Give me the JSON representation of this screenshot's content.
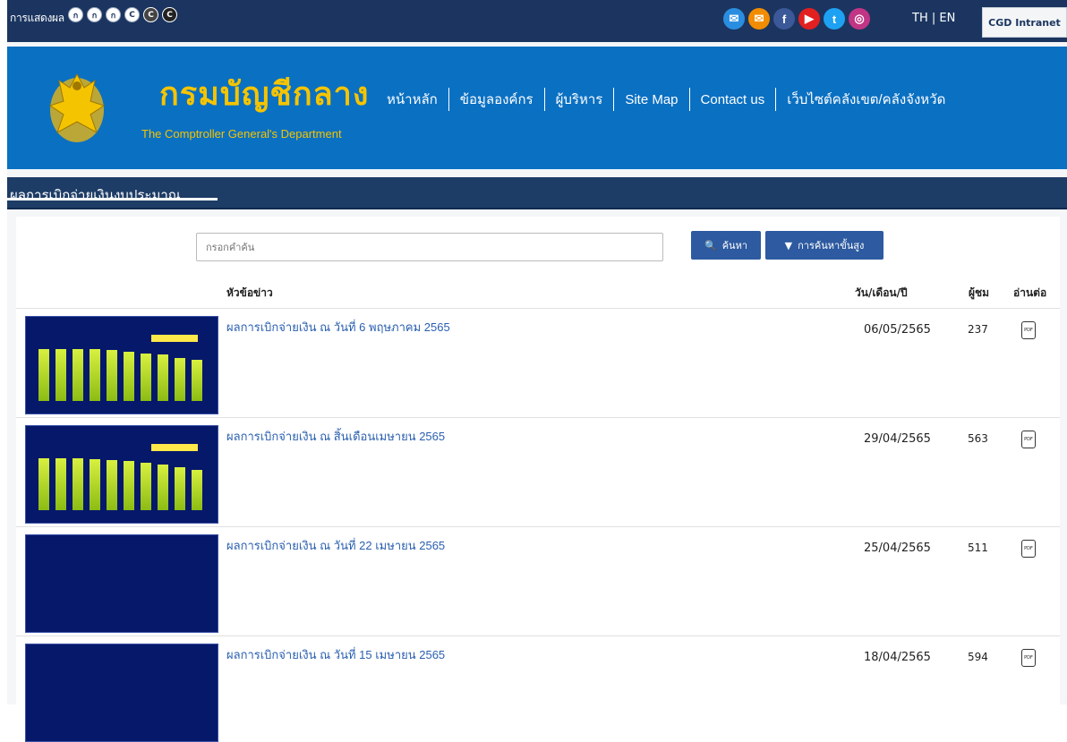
{
  "topbar": {
    "display_label": "การแสดงผล",
    "font_buttons": [
      "ก",
      "ก",
      "ก",
      "C",
      "C",
      "C"
    ],
    "socials": [
      {
        "icon": "email-icon",
        "glyph": "✉",
        "color": "#2a8ee0"
      },
      {
        "icon": "email-orange-icon",
        "glyph": "✉",
        "color": "#f28c00"
      },
      {
        "icon": "facebook-icon",
        "glyph": "f",
        "color": "#3b5998"
      },
      {
        "icon": "youtube-icon",
        "glyph": "▶",
        "color": "#e22020"
      },
      {
        "icon": "twitter-icon",
        "glyph": "t",
        "color": "#1da1f2"
      },
      {
        "icon": "instagram-icon",
        "glyph": "◎",
        "color": "#c13584"
      }
    ],
    "lang_th": "TH",
    "lang_sep": "|",
    "lang_en": "EN",
    "intranet_label": "CGD Intranet"
  },
  "header": {
    "brand_th": "กรมบัญชีกลาง",
    "brand_en": "The Comptroller General's Department",
    "nav": [
      "หน้าหลัก",
      "ข้อมูลองค์กร",
      "ผู้บริหาร",
      "Site Map",
      "Contact us",
      "เว็บไซต์คลังเขต/คลังจังหวัด"
    ]
  },
  "section": {
    "title": "ผลการเบิกจ่ายเงินงบประมาณ"
  },
  "search": {
    "placeholder": "กรอกคำค้น",
    "search_label": "ค้นหา",
    "advanced_label": "การค้นหาขั้นสูง"
  },
  "table": {
    "headers": {
      "title": "หัวข้อข่าว",
      "date": "วัน/เดือน/ปี",
      "views": "ผู้ชม",
      "read": "อ่านต่อ"
    },
    "rows": [
      {
        "title": "ผลการเบิกจ่ายเงิน ณ วันที่ 6 พฤษภาคม 2565",
        "date": "06/05/2565",
        "views": "237",
        "chart": true
      },
      {
        "title": "ผลการเบิกจ่ายเงิน ณ สิ้นเดือนเมษายน 2565",
        "date": "29/04/2565",
        "views": "563",
        "chart": true
      },
      {
        "title": "ผลการเบิกจ่ายเงิน ณ วันที่ 22 เมษายน 2565",
        "date": "25/04/2565",
        "views": "511",
        "chart": false
      },
      {
        "title": "ผลการเบิกจ่ายเงิน ณ วันที่ 15 เมษายน 2565",
        "date": "18/04/2565",
        "views": "594",
        "chart": false
      }
    ]
  }
}
